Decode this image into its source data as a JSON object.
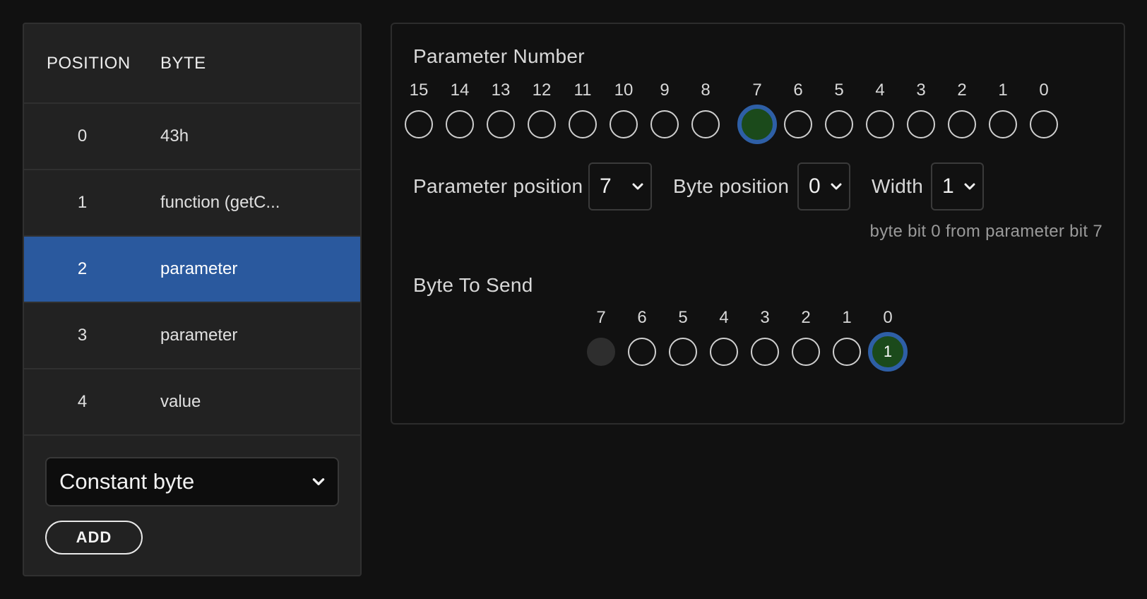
{
  "table": {
    "headers": {
      "position": "POSITION",
      "byte": "BYTE"
    },
    "rows": [
      {
        "position": "0",
        "byte": "43h"
      },
      {
        "position": "1",
        "byte": "function (getC..."
      },
      {
        "position": "2",
        "byte": "parameter"
      },
      {
        "position": "3",
        "byte": "parameter"
      },
      {
        "position": "4",
        "byte": "value"
      }
    ],
    "selected_index": 2
  },
  "add": {
    "type_value": "Constant byte",
    "add_label": "ADD"
  },
  "parameter_number": {
    "label": "Parameter Number",
    "bits": [
      "15",
      "14",
      "13",
      "12",
      "11",
      "10",
      "9",
      "8",
      "7",
      "6",
      "5",
      "4",
      "3",
      "2",
      "1",
      "0"
    ],
    "active_bit": "7"
  },
  "controls": {
    "param_position_label": "Parameter position",
    "param_position_value": "7",
    "byte_position_label": "Byte position",
    "byte_position_value": "0",
    "width_label": "Width",
    "width_value": "1",
    "hint": "byte bit 0 from parameter bit 7"
  },
  "byte_to_send": {
    "label": "Byte To Send",
    "bits": [
      "7",
      "6",
      "5",
      "4",
      "3",
      "2",
      "1",
      "0"
    ],
    "active_bit": "0",
    "active_value": "1",
    "disabled_bit": "7"
  },
  "colors": {
    "selected_row": "#2a599e",
    "active_ring": "#2e5fa6",
    "active_fill": "#1b4a1b"
  }
}
